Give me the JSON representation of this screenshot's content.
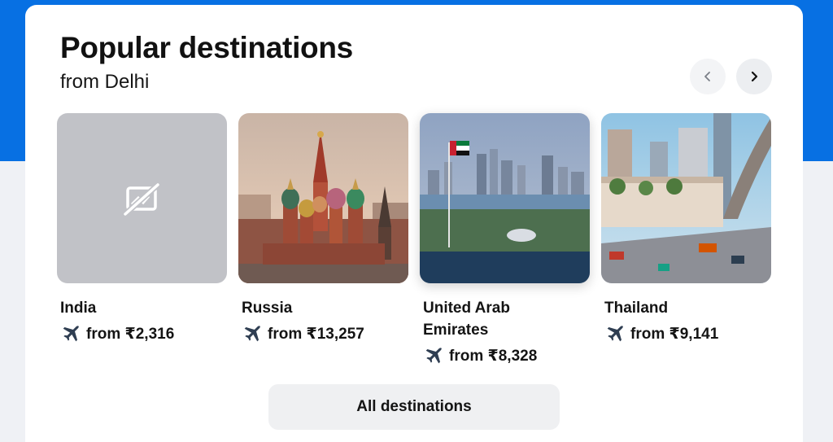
{
  "header": {
    "title": "Popular destinations",
    "subtitle": "from Delhi"
  },
  "nav": {
    "prev_icon": "chevron-left-icon",
    "next_icon": "chevron-right-icon"
  },
  "destinations": [
    {
      "name": "India",
      "price": "from ₹2,316",
      "image": "image-unavailable-icon"
    },
    {
      "name": "Russia",
      "price": "from ₹13,257",
      "image": "moscow-cathedral-photo"
    },
    {
      "name": "United Arab Emirates",
      "price": "from ₹8,328",
      "image": "uae-waterfront-photo"
    },
    {
      "name": "Thailand",
      "price": "from ₹9,141",
      "image": "bangkok-street-photo"
    }
  ],
  "footer": {
    "all_label": "All destinations"
  },
  "colors": {
    "brand_blue": "#0770e3",
    "placeholder_grey": "#c1c2c7",
    "plane_icon": "#2f3e52"
  }
}
